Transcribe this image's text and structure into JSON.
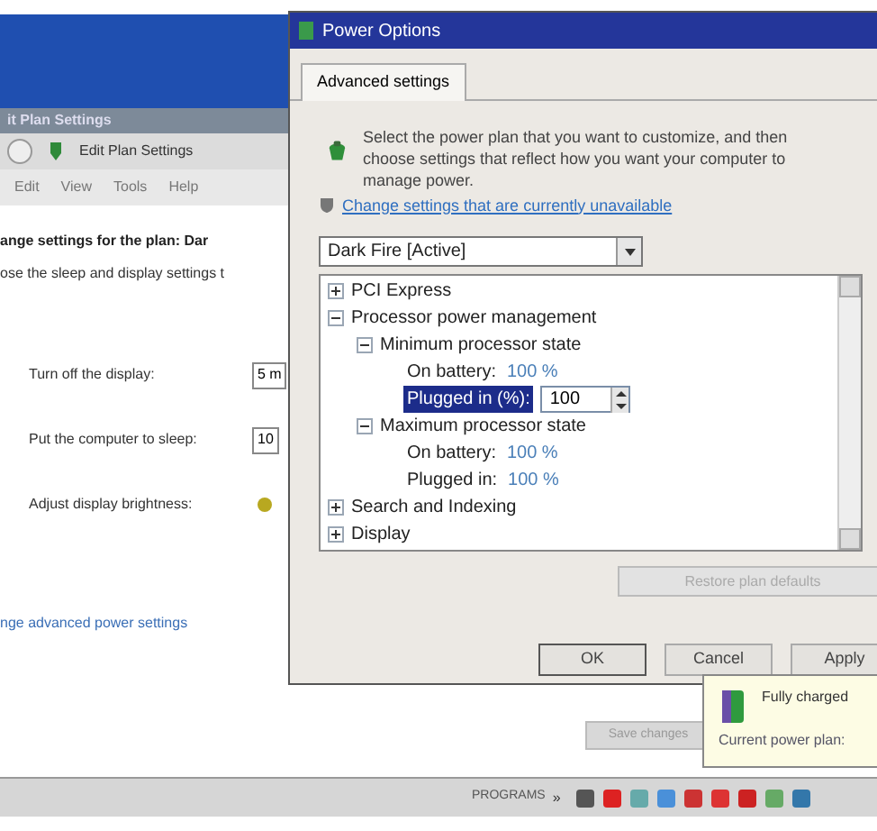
{
  "background_window": {
    "title": "it Plan Settings",
    "breadcrumb": "Edit Plan Settings",
    "menu": [
      "Edit",
      "View",
      "Tools",
      "Help"
    ],
    "heading": "ange settings for the plan: Dar",
    "subheading": "ose the sleep and display settings t",
    "settings": [
      {
        "kind": "field",
        "label": "Turn off the display:",
        "value": "5 m"
      },
      {
        "kind": "field",
        "label": "Put the computer to sleep:",
        "value": "10"
      },
      {
        "kind": "brightness",
        "label": "Adjust display brightness:"
      }
    ],
    "link": "nge advanced power settings",
    "save_button": "Save changes"
  },
  "dialog": {
    "title": "Power Options",
    "tabs": [
      {
        "label": "Advanced settings",
        "selected": true
      }
    ],
    "description": "Select the power plan that you want to customize, and then choose settings that reflect how you want your computer to manage power.",
    "link": "Change settings that are currently unavailable",
    "plan": "Dark Fire [Active]",
    "tree": [
      {
        "label": "PCI Express",
        "expanded": false
      },
      {
        "label": "Processor power management",
        "expanded": true,
        "children": [
          {
            "label": "Minimum processor state",
            "expanded": true,
            "children": [
              {
                "label": "On battery:",
                "value": "100 %",
                "selected": false
              },
              {
                "label": "Plugged in (%):",
                "value": "100",
                "selected": true
              }
            ]
          },
          {
            "label": "Maximum processor state",
            "expanded": true,
            "children": [
              {
                "label": "On battery:",
                "value": "100 %",
                "selected": false
              },
              {
                "label": "Plugged in:",
                "value": "100 %",
                "selected": false
              }
            ]
          }
        ]
      },
      {
        "label": "Search and Indexing",
        "expanded": false
      },
      {
        "label": "Display",
        "expanded": false
      }
    ],
    "restore_button": "Restore plan defaults",
    "buttons": [
      "OK",
      "Cancel",
      "Apply"
    ]
  },
  "balloon": {
    "title": "Fully charged",
    "text": "Current power plan:"
  },
  "taskbar": {
    "toolbar": "PROGRAMS",
    "chevron": "»"
  }
}
